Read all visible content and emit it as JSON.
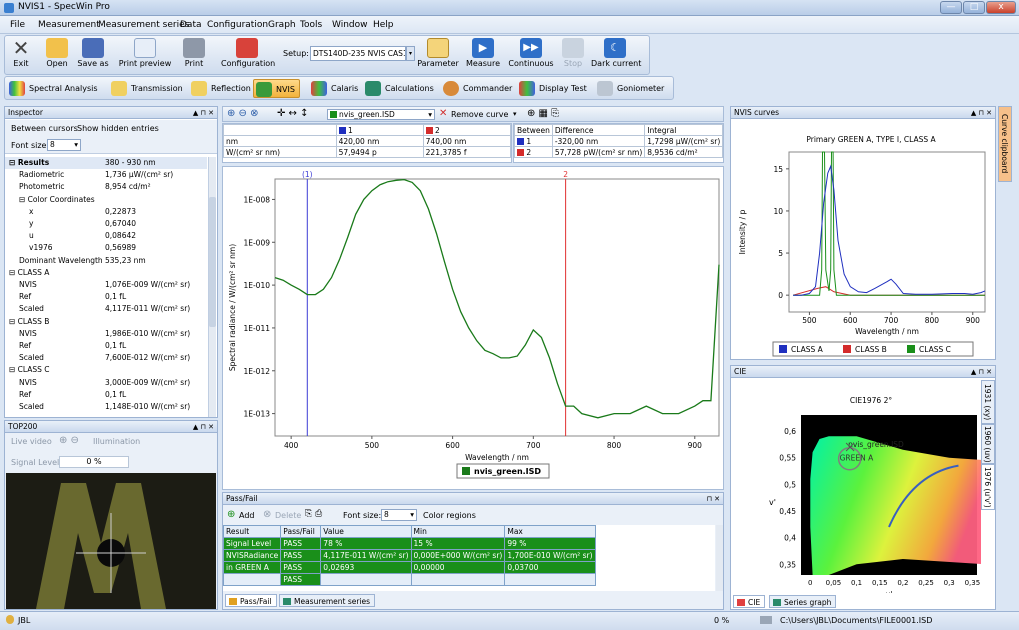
{
  "window": {
    "title": "NVIS1 - SpecWin Pro",
    "min": "—",
    "max": "□",
    "close": "x"
  },
  "menu": [
    "File",
    "Measurement",
    "Measurement series",
    "Data",
    "Configuration",
    "Graph",
    "Tools",
    "Window",
    "Help"
  ],
  "toolbar": {
    "exit": "Exit",
    "open": "Open",
    "save_as": "Save as",
    "print_preview": "Print preview",
    "print": "Print",
    "configuration": "Configuration",
    "setup_label": "Setup:",
    "setup_value": "DTS140D-235 NVIS CAS1(",
    "parameter": "Parameter",
    "measure": "Measure",
    "continuous": "Continuous",
    "stop": "Stop",
    "dark_current": "Dark current"
  },
  "modes": [
    "Spectral Analysis",
    "Transmission",
    "Reflection",
    "NVIS",
    "Calaris",
    "Calculations",
    "Commander",
    "Display Test",
    "Goniometer"
  ],
  "inspector": {
    "title": "Inspector",
    "between_cursors": "Between cursors",
    "show_hidden": "Show hidden entries",
    "font_size_label": "Font size:",
    "font_size_value": "8",
    "rows": [
      {
        "label": "Results",
        "value": "380 - 930 nm",
        "level": 0,
        "bold": true,
        "toggle": "⊟"
      },
      {
        "label": "Radiometric",
        "value": "1,736 µW/(cm² sr)",
        "level": 1
      },
      {
        "label": "Photometric",
        "value": "8,954 cd/m²",
        "level": 1
      },
      {
        "label": "Color Coordinates",
        "value": "",
        "level": 1,
        "toggle": "⊟"
      },
      {
        "label": "x",
        "value": "0,22873",
        "level": 2
      },
      {
        "label": "y",
        "value": "0,67040",
        "level": 2
      },
      {
        "label": "u",
        "value": "0,08642",
        "level": 2
      },
      {
        "label": "v1976",
        "value": "0,56989",
        "level": 2
      },
      {
        "label": "Dominant Wavelength",
        "value": "535,23 nm",
        "level": 1
      },
      {
        "label": "CLASS A",
        "value": "",
        "level": 0,
        "toggle": "⊟"
      },
      {
        "label": "NVIS",
        "value": "1,076E-009 W/(cm² sr)",
        "level": 1
      },
      {
        "label": "Ref",
        "value": "0,1 fL",
        "level": 1
      },
      {
        "label": "Scaled",
        "value": "4,117E-011 W/(cm² sr)",
        "level": 1
      },
      {
        "label": "CLASS B",
        "value": "",
        "level": 0,
        "toggle": "⊟"
      },
      {
        "label": "NVIS",
        "value": "1,986E-010 W/(cm² sr)",
        "level": 1
      },
      {
        "label": "Ref",
        "value": "0,1 fL",
        "level": 1
      },
      {
        "label": "Scaled",
        "value": "7,600E-012 W/(cm² sr)",
        "level": 1
      },
      {
        "label": "CLASS C",
        "value": "",
        "level": 0,
        "toggle": "⊟"
      },
      {
        "label": "NVIS",
        "value": "3,000E-009 W/(cm² sr)",
        "level": 1
      },
      {
        "label": "Ref",
        "value": "0,1 fL",
        "level": 1
      },
      {
        "label": "Scaled",
        "value": "1,148E-010 W/(cm² sr)",
        "level": 1
      }
    ]
  },
  "top200": {
    "title": "TOP200",
    "live_video": "Live video",
    "illumination": "Illumination",
    "signal_label": "Signal Level:",
    "signal_value": "0 %"
  },
  "graph_toolbar": {
    "curve": "nvis_green.ISD",
    "remove_curve": "Remove curve"
  },
  "cursor_table": {
    "col1": "1",
    "col2": "2",
    "rows": [
      [
        "nm",
        "420,00 nm",
        "740,00 nm"
      ],
      [
        "W/(cm² sr nm)",
        "57,9494 p",
        "221,3785 f"
      ]
    ]
  },
  "between_table": {
    "headers": [
      "Between",
      "Difference",
      "Integral"
    ],
    "rows": [
      [
        "1",
        "-320,00 nm",
        "1,7298 µW/(cm² sr)"
      ],
      [
        "2",
        "57,728 pW/(cm² sr nm)",
        "8,9536 cd/m²"
      ]
    ]
  },
  "main_chart": {
    "ylabel": "Spectral radiance / W/(cm² sr nm)",
    "xlabel": "Wavelength / nm",
    "yticks": [
      "1E-008",
      "1E-009",
      "1E-010",
      "1E-011",
      "1E-012",
      "1E-013"
    ],
    "xticks": [
      "400",
      "500",
      "600",
      "700",
      "800",
      "900"
    ],
    "cursor1": "(1)",
    "cursor2": "2",
    "legend": "nvis_green.ISD",
    "color_curve": "#1a7a1a",
    "color_c1": "#3b3bd6",
    "color_c2": "#e03030"
  },
  "chart_data": {
    "type": "line",
    "title": "",
    "xlabel": "Wavelength / nm",
    "ylabel": "Spectral radiance / W/(cm² sr nm)",
    "xlim": [
      380,
      930
    ],
    "y_scale": "log",
    "ylim": [
      3e-14,
      3e-08
    ],
    "legend": "bottom",
    "series": [
      {
        "name": "nvis_green.ISD",
        "x": [
          380,
          390,
          400,
          410,
          420,
          430,
          440,
          450,
          460,
          470,
          480,
          490,
          500,
          510,
          520,
          530,
          540,
          550,
          560,
          570,
          580,
          590,
          600,
          610,
          620,
          630,
          640,
          650,
          660,
          670,
          680,
          690,
          700,
          710,
          720,
          730,
          740,
          750,
          760,
          780,
          800,
          820,
          840,
          860,
          880,
          900,
          910,
          920,
          930
        ],
        "y": [
          1.5e-10,
          1.3e-10,
          1e-10,
          8e-11,
          6e-11,
          6e-11,
          8e-11,
          1.5e-10,
          4e-10,
          1.3e-09,
          4.5e-09,
          1e-08,
          1.6e-08,
          2.2e-08,
          2.6e-08,
          2.8e-08,
          2.9e-08,
          2.5e-08,
          1.6e-08,
          6e-09,
          1.6e-09,
          3.5e-10,
          8e-11,
          2.4e-11,
          1e-11,
          5e-12,
          3e-12,
          2.5e-12,
          2e-12,
          2e-12,
          2.2e-12,
          4e-12,
          9e-12,
          6e-12,
          2e-12,
          5e-13,
          1.5e-13,
          1.5e-13,
          1e-13,
          8e-14,
          1e-13,
          1e-13,
          1.5e-13,
          1e-13,
          1e-13,
          1.5e-13,
          2e-13,
          2e-13,
          3e-10
        ]
      }
    ]
  },
  "passfail": {
    "title": "Pass/Fail",
    "add": "Add",
    "delete": "Delete",
    "font_size_label": "Font size:",
    "font_size_value": "8",
    "color_regions": "Color regions",
    "headers": [
      "Result",
      "Pass/Fail",
      "Value",
      "Min",
      "Max"
    ],
    "rows": [
      [
        "Signal Level",
        "PASS",
        "78 %",
        "15 %",
        "99 %"
      ],
      [
        "NVISRadiance",
        "PASS",
        "4,117E-011 W/(cm² sr)",
        "0,000E+000 W/(cm² sr)",
        "1,700E-010 W/(cm² sr)"
      ],
      [
        "in GREEN A",
        "PASS",
        "0,02693",
        "0,00000",
        "0,03700"
      ],
      [
        "",
        "PASS",
        "",
        "",
        ""
      ]
    ],
    "tab_passfail": "Pass/Fail",
    "tab_series": "Measurement series"
  },
  "nvis_curves": {
    "title": "NVIS curves",
    "chart_title": "Primary GREEN A, TYPE I, CLASS A",
    "ylabel": "Intensity / p",
    "xlabel": "Wavelength / nm",
    "yticks": [
      "0",
      "5",
      "10",
      "15"
    ],
    "xticks": [
      "500",
      "600",
      "700",
      "800",
      "900"
    ],
    "legend": [
      "CLASS A",
      "CLASS B",
      "CLASS C"
    ],
    "colors": [
      "#1f2fbf",
      "#d42b2b",
      "#1a8f1a"
    ],
    "side_tab": "Curve clipboard"
  },
  "cie": {
    "title": "CIE",
    "chart_title": "CIE1976 2°",
    "ylabel": "v'",
    "xlabel": "u'",
    "yticks": [
      "0,35",
      "0,4",
      "0,45",
      "0,5",
      "0,55",
      "0,6"
    ],
    "xticks": [
      "0",
      "0,05",
      "0,1",
      "0,15",
      "0,2",
      "0,25",
      "0,3",
      "0,35"
    ],
    "point_label": "nvis_green.ISD",
    "region_label": "GREEN A",
    "side_tabs": [
      "1931 (xy)",
      "1960 (uv)",
      "1976 (u'v')"
    ],
    "tab_cie": "CIE",
    "tab_series_graph": "Series graph"
  },
  "status": {
    "user": "JBL",
    "percent": "0 %",
    "file": "C:\\Users\\JBL\\Documents\\FILE0001.ISD"
  }
}
